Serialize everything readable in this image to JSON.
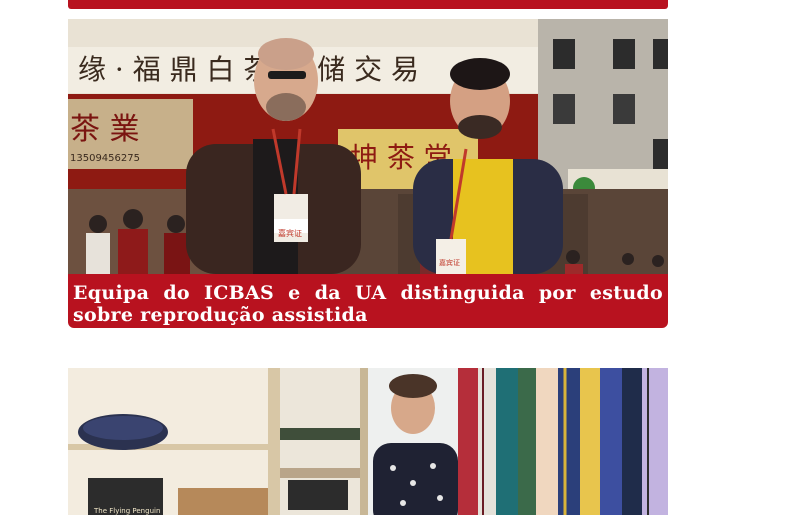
{
  "articles": [
    {
      "headline": "Equipa do ICBAS e da UA distinguida por estudo sobre reprodução assistida",
      "photo_signs": {
        "banner_top": "缘 · 福 鼎 白 茶 仓 储 交 易",
        "shop_left": "茶 業",
        "phone": "13509456275",
        "shop_center": "坤 茶 堂",
        "badge_left": "嘉宾证",
        "badge_right": "嘉宾证"
      }
    },
    {
      "photo_signs": {
        "box_label": "The Flying Penguin"
      }
    }
  ],
  "colors": {
    "accent": "#b8121f",
    "caption_text": "#ffffff",
    "background": "#ffffff"
  }
}
